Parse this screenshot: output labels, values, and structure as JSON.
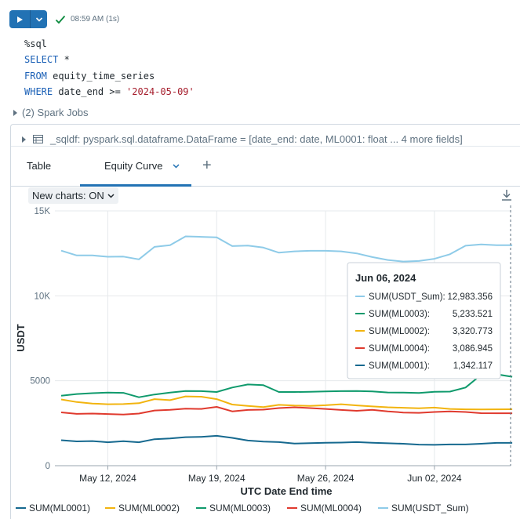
{
  "cell": {
    "run_time": "08:59 AM (1s)",
    "code_lines": [
      [
        {
          "t": "%sql",
          "c": "plain"
        }
      ],
      [
        {
          "t": "SELECT",
          "c": "kw"
        },
        {
          "t": " *",
          "c": "plain"
        }
      ],
      [
        {
          "t": "FROM",
          "c": "kw"
        },
        {
          "t": " equity_time_series",
          "c": "plain"
        }
      ],
      [
        {
          "t": "WHERE",
          "c": "kw"
        },
        {
          "t": " date_end >= ",
          "c": "plain"
        },
        {
          "t": "'2024-05-09'",
          "c": "str"
        }
      ]
    ],
    "spark_jobs": "(2) Spark Jobs"
  },
  "result": {
    "df_summary": "_sqldf:  pyspark.sql.dataframe.DataFrame = [date_end: date, ML0001: float ... 4 more fields]",
    "tabs": [
      {
        "label": "Table",
        "active": false
      },
      {
        "label": "Equity Curve",
        "active": true
      }
    ],
    "new_charts": "New charts: ON"
  },
  "colors": {
    "accent": "#2272b4",
    "success": "#0b8a3e",
    "ML0001": "#16698f",
    "ML0002": "#f2b40f",
    "ML0003": "#0f9a6c",
    "ML0004": "#e03a2e",
    "USDT_Sum": "#8ecbe8"
  },
  "chart_data": {
    "type": "line",
    "xlabel": "UTC Date End time",
    "ylabel": "USDT",
    "ylim": [
      0,
      15000
    ],
    "yticks": [
      0,
      5000,
      10000,
      15000
    ],
    "ytick_labels": [
      "0",
      "5000",
      "10K",
      "15K"
    ],
    "x_tick_labels": [
      {
        "date": "2024-05-12",
        "label": "May 12, 2024"
      },
      {
        "date": "2024-05-19",
        "label": "May 19, 2024"
      },
      {
        "date": "2024-05-26",
        "label": "May 26, 2024"
      },
      {
        "date": "2024-06-02",
        "label": "Jun 02, 2024"
      }
    ],
    "grid": true,
    "legend_placement": "bottom",
    "x": [
      "2024-05-09",
      "2024-05-10",
      "2024-05-11",
      "2024-05-12",
      "2024-05-13",
      "2024-05-14",
      "2024-05-15",
      "2024-05-16",
      "2024-05-17",
      "2024-05-18",
      "2024-05-19",
      "2024-05-20",
      "2024-05-21",
      "2024-05-22",
      "2024-05-23",
      "2024-05-24",
      "2024-05-25",
      "2024-05-26",
      "2024-05-27",
      "2024-05-28",
      "2024-05-29",
      "2024-05-30",
      "2024-05-31",
      "2024-06-01",
      "2024-06-02",
      "2024-06-03",
      "2024-06-04",
      "2024-06-05",
      "2024-06-06",
      "2024-06-07"
    ],
    "series": [
      {
        "name": "SUM(ML0001)",
        "key": "ML0001",
        "values": [
          1500,
          1430,
          1450,
          1380,
          1440,
          1380,
          1560,
          1600,
          1680,
          1700,
          1760,
          1640,
          1480,
          1420,
          1390,
          1300,
          1330,
          1350,
          1360,
          1390,
          1350,
          1320,
          1290,
          1240,
          1230,
          1250,
          1250,
          1290,
          1342,
          1342
        ]
      },
      {
        "name": "SUM(ML0002)",
        "key": "ML0002",
        "values": [
          3900,
          3750,
          3660,
          3620,
          3630,
          3680,
          3920,
          3860,
          4080,
          4060,
          3920,
          3600,
          3520,
          3450,
          3580,
          3540,
          3520,
          3560,
          3620,
          3550,
          3490,
          3440,
          3410,
          3380,
          3420,
          3340,
          3320,
          3310,
          3320,
          3321
        ]
      },
      {
        "name": "SUM(ML0003)",
        "key": "ML0003",
        "values": [
          4120,
          4220,
          4270,
          4300,
          4290,
          4030,
          4190,
          4300,
          4400,
          4390,
          4340,
          4600,
          4780,
          4740,
          4340,
          4340,
          4350,
          4370,
          4390,
          4400,
          4370,
          4310,
          4300,
          4280,
          4350,
          4360,
          4600,
          5350,
          5380,
          5234
        ]
      },
      {
        "name": "SUM(ML0004)",
        "key": "ML0004",
        "values": [
          3140,
          3050,
          3070,
          3040,
          3010,
          3070,
          3250,
          3290,
          3360,
          3340,
          3460,
          3200,
          3280,
          3300,
          3390,
          3440,
          3390,
          3340,
          3280,
          3230,
          3290,
          3200,
          3130,
          3110,
          3160,
          3200,
          3160,
          3090,
          3087,
          3087
        ]
      },
      {
        "name": "SUM(USDT_Sum)",
        "key": "USDT_Sum",
        "values": [
          12660,
          12380,
          12380,
          12300,
          12310,
          12150,
          12880,
          12980,
          13500,
          13470,
          13440,
          12930,
          12960,
          12840,
          12540,
          12620,
          12650,
          12650,
          12620,
          12500,
          12280,
          12110,
          12020,
          12050,
          12180,
          12450,
          12950,
          13030,
          12983,
          12983
        ]
      }
    ],
    "tooltip": {
      "title": "Jun 06, 2024",
      "rows": [
        {
          "label": "SUM(USDT_Sum):",
          "value": "12,983.356",
          "key": "USDT_Sum"
        },
        {
          "label": "SUM(ML0003):",
          "value": "5,233.521",
          "key": "ML0003"
        },
        {
          "label": "SUM(ML0002):",
          "value": "3,320.773",
          "key": "ML0002"
        },
        {
          "label": "SUM(ML0004):",
          "value": "3,086.945",
          "key": "ML0004"
        },
        {
          "label": "SUM(ML0001):",
          "value": "1,342.117",
          "key": "ML0001"
        }
      ]
    }
  }
}
